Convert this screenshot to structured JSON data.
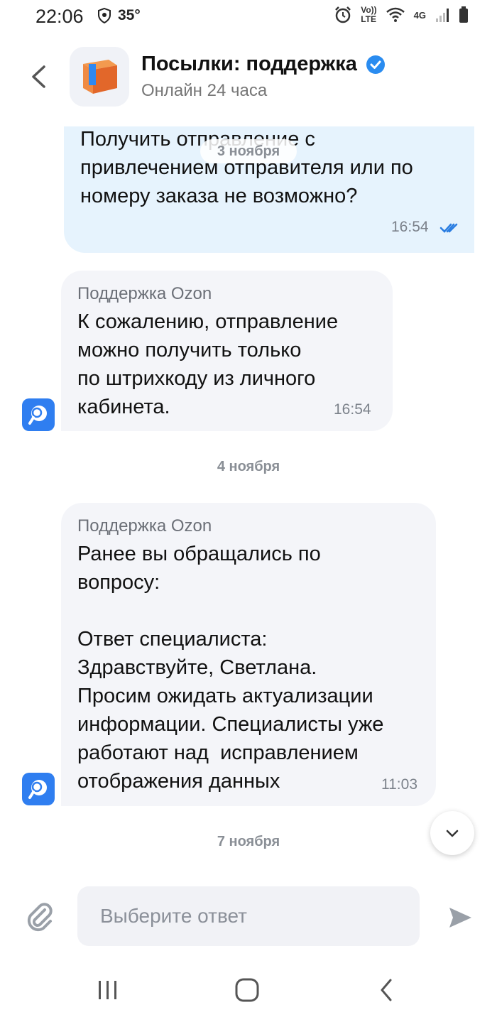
{
  "status_bar": {
    "time": "22:06",
    "temperature": "35°",
    "network_vo": "Vo))",
    "network_lte": "LTE",
    "network_4g": "4G"
  },
  "header": {
    "title": "Посылки: поддержка",
    "subtitle": "Онлайн 24 часа"
  },
  "messages": [
    {
      "direction": "outgoing",
      "text_lines": [
        "Получить отправление с",
        "привлечением отправителя или по",
        "номеру заказа не возможно?"
      ],
      "time": "16:54",
      "read": true
    },
    {
      "direction": "incoming",
      "sender": "Поддержка Ozon",
      "text_lines": [
        "К сожалению, отправление",
        "можно получить только",
        "по штрихкоду из личного",
        "кабинета."
      ],
      "time": "16:54"
    },
    {
      "direction": "incoming",
      "sender": "Поддержка Ozon",
      "text_lines": [
        "Ранее вы обращались по",
        "вопросу:",
        "",
        "Ответ специалиста:",
        "Здравствуйте, Светлана.",
        "Просим ожидать актуализации",
        "информации. Специалисты уже",
        "работают над  исправлением",
        "отображения данных"
      ],
      "time": "11:03"
    }
  ],
  "dates": [
    "3 ноября",
    "4 ноября",
    "7 ноября"
  ],
  "composer": {
    "placeholder": "Выберите ответ"
  },
  "colors": {
    "outgoing_bubble": "#e6f3fd",
    "incoming_bubble": "#f4f5f9",
    "verified_badge": "#2a8cf0",
    "read_ticks": "#2a7de1",
    "ozon_avatar": "#2f7ef0"
  }
}
